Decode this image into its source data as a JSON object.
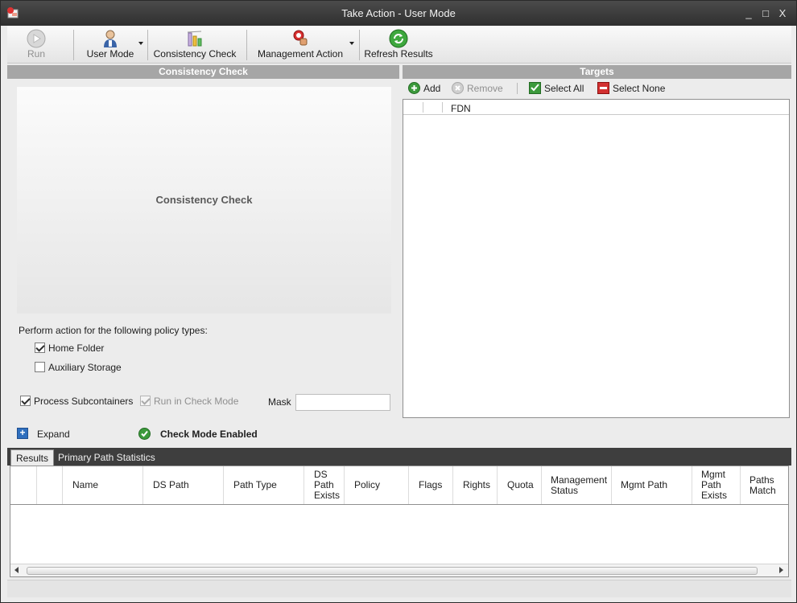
{
  "window": {
    "title": "Take Action - User Mode",
    "minimize_glyph": "_",
    "maximize_glyph": "□",
    "close_glyph": "X"
  },
  "toolbar": {
    "run_label": "Run",
    "user_mode_label": "User Mode",
    "consistency_check_label": "Consistency Check",
    "management_action_label": "Management Action",
    "refresh_results_label": "Refresh Results"
  },
  "left_panel": {
    "header": "Consistency Check",
    "placeholder_title": "Consistency Check",
    "policy_types_label": "Perform action for the following policy types:",
    "home_folder_label": "Home Folder",
    "home_folder_checked": true,
    "auxiliary_storage_label": "Auxiliary Storage",
    "auxiliary_storage_checked": false,
    "process_subcontainers_label": "Process Subcontainers",
    "process_subcontainers_checked": true,
    "run_in_check_mode_label": "Run in Check Mode",
    "run_in_check_mode_checked": true,
    "mask_label": "Mask",
    "mask_value": ""
  },
  "targets": {
    "header": "Targets",
    "add_label": "Add",
    "remove_label": "Remove",
    "select_all_label": "Select All",
    "select_none_label": "Select None",
    "column_fdn": "FDN"
  },
  "expand_row": {
    "expand_label": "Expand",
    "check_mode_label": "Check Mode Enabled"
  },
  "tabs": {
    "results": "Results",
    "primary_path_statistics": "Primary Path Statistics"
  },
  "results_grid": {
    "columns": [
      "Name",
      "DS Path",
      "Path Type",
      "DS Path Exists",
      "Policy",
      "Flags",
      "Rights",
      "Quota",
      "Management Status",
      "Mgmt Path",
      "Mgmt Path Exists",
      "Paths Match"
    ]
  },
  "colors": {
    "accent_green": "#3c9a3c",
    "remove_red": "#d23030",
    "panel_header_gray": "#a6a6a6"
  }
}
